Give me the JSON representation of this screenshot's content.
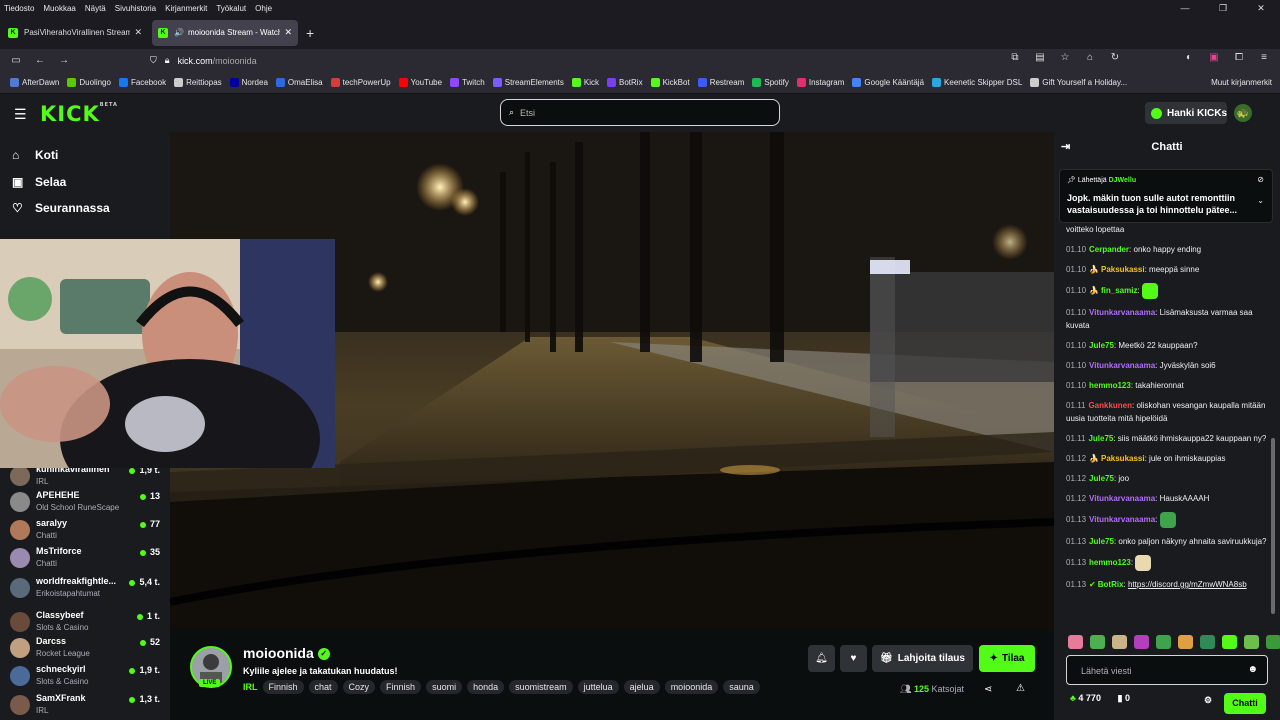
{
  "browser": {
    "menu": [
      "Tiedosto",
      "Muokkaa",
      "Näytä",
      "Sivuhistoria",
      "Kirjanmerkit",
      "Työkalut",
      "Ohje"
    ],
    "tabs": [
      {
        "title": "PasiViherahoVirallinen Stream",
        "active": false
      },
      {
        "title": "moioonida Stream - Watch",
        "active": true
      }
    ],
    "url_host": "kick.com",
    "url_path": "/moioonida",
    "bookmarks": [
      {
        "label": "AfterDawn",
        "color": "#4f7bd6"
      },
      {
        "label": "Duolingo",
        "color": "#58cc02"
      },
      {
        "label": "Facebook",
        "color": "#1877f2"
      },
      {
        "label": "Reittiopas",
        "color": "#cccccc"
      },
      {
        "label": "Nordea",
        "color": "#0000a0"
      },
      {
        "label": "OmaElisa",
        "color": "#2b6be0"
      },
      {
        "label": "techPowerUp",
        "color": "#d83b3b"
      },
      {
        "label": "YouTube",
        "color": "#ff0000"
      },
      {
        "label": "Twitch",
        "color": "#9146ff"
      },
      {
        "label": "StreamElements",
        "color": "#7a5cff"
      },
      {
        "label": "Kick",
        "color": "#53fc18"
      },
      {
        "label": "BotRix",
        "color": "#7b3ff2"
      },
      {
        "label": "KickBot",
        "color": "#53fc18"
      },
      {
        "label": "Restream",
        "color": "#3b5bfd"
      },
      {
        "label": "Spotify",
        "color": "#1db954"
      },
      {
        "label": "Instagram",
        "color": "#e1306c"
      },
      {
        "label": "Google Kääntäjä",
        "color": "#4285f4"
      },
      {
        "label": "Keenetic Skipper DSL",
        "color": "#2aa7e0"
      },
      {
        "label": "Gift Yourself a Holiday...",
        "color": "#cccccc"
      }
    ],
    "other_bookmarks": "Muut kirjanmerkit"
  },
  "site": {
    "logo": "KICK",
    "logo_beta": "BETA",
    "search_placeholder": "Etsi",
    "kicks_label": "Hanki KICKs"
  },
  "sidebar": {
    "nav": [
      {
        "label": "Koti",
        "icon": "home-icon"
      },
      {
        "label": "Selaa",
        "icon": "browse-icon"
      },
      {
        "label": "Seurannassa",
        "icon": "heart-icon"
      }
    ],
    "channels": [
      {
        "name": "kuninkavirallinen",
        "category": "IRL",
        "viewers": "1,9 t."
      },
      {
        "name": "APEHEHE",
        "category": "Old School RuneScape",
        "viewers": "13"
      },
      {
        "name": "saralyy",
        "category": "Chatti",
        "viewers": "77"
      },
      {
        "name": "MsTriforce",
        "category": "Chatti",
        "viewers": "35"
      },
      {
        "name": "worldfreakfightle...",
        "category": "Erikoistapahtumat",
        "viewers": "5,4 t."
      },
      {
        "name": "Classybeef",
        "category": "Slots & Casino",
        "viewers": "1 t."
      },
      {
        "name": "Darcss",
        "category": "Rocket League",
        "viewers": "52"
      },
      {
        "name": "schneckyirl",
        "category": "Slots & Casino",
        "viewers": "1,9 t."
      },
      {
        "name": "SamXFrank",
        "category": "IRL",
        "viewers": "1,3 t."
      }
    ]
  },
  "stream": {
    "streamer": "moioonida",
    "live_badge": "LIVE",
    "title": "Kyliile ajelee ja takatukan huudatus!",
    "category": "IRL",
    "tags": [
      "Finnish",
      "chat",
      "Cozy",
      "Finnish",
      "suomi",
      "honda",
      "suomistream",
      "juttelua",
      "ajelua",
      "moioonida",
      "sauna"
    ],
    "gift_label": "Lahjoita tilaus",
    "follow_label": "Tilaa",
    "viewer_count": "125",
    "viewer_label": "Katsojat"
  },
  "chat": {
    "title": "Chatti",
    "pinned_by_label": "Lähettäjä",
    "pinned_by": "DJWellu",
    "pinned_text": "Jopk. mäkin tuon sulle autot remonttiin vastaisuudessa ja toi hinnottelu pätee...",
    "messages": [
      {
        "time": "",
        "user": "",
        "color": "#ffffff",
        "text": "voitteko lopettaa"
      },
      {
        "time": "01.10",
        "user": "Cerpander",
        "color": "#53fc18",
        "text": "onko happy ending"
      },
      {
        "time": "01.10",
        "user": "Paksukassi",
        "color": "#f5c518",
        "text": "meeppä sinne"
      },
      {
        "time": "01.10",
        "user": "fin_samiz",
        "color": "#53fc18",
        "text": ""
      },
      {
        "time": "01.10",
        "user": "Vitunkarvanaama",
        "color": "#b36cff",
        "text": "Lisämaksusta varmaa saa kuvata"
      },
      {
        "time": "01.10",
        "user": "Jule75",
        "color": "#53fc18",
        "text": "Meetkö 22 kauppaan?"
      },
      {
        "time": "01.10",
        "user": "Vitunkarvanaama",
        "color": "#b36cff",
        "text": "Jyväskylän soi6"
      },
      {
        "time": "01.10",
        "user": "hemmo123",
        "color": "#53fc18",
        "text": "takahieronnat"
      },
      {
        "time": "01.11",
        "user": "Gankkunen",
        "color": "#ff4b4b",
        "text": "oliskohan vesangan kaupalla mitään uusia tuotteita mitä hipelöidä"
      },
      {
        "time": "01.11",
        "user": "Jule75",
        "color": "#53fc18",
        "text": "siis määtkö ihmiskauppa22 kauppaan ny?"
      },
      {
        "time": "01.12",
        "user": "Paksukassi",
        "color": "#f5c518",
        "text": "jule on ihmiskauppias"
      },
      {
        "time": "01.12",
        "user": "Jule75",
        "color": "#53fc18",
        "text": "joo"
      },
      {
        "time": "01.12",
        "user": "Vitunkarvanaama",
        "color": "#b36cff",
        "text": "HauskAAAAH"
      },
      {
        "time": "01.13",
        "user": "Vitunkarvanaama",
        "color": "#b36cff",
        "text": ""
      },
      {
        "time": "01.13",
        "user": "Jule75",
        "color": "#53fc18",
        "text": "onko paljon näkyny ahnaita saviruukkuja?"
      },
      {
        "time": "01.13",
        "user": "hemmo123",
        "color": "#53fc18",
        "text": ""
      },
      {
        "time": "01.13",
        "user": "BotRix",
        "color": "#53fc18",
        "text": "https://discord.gg/mZmwWNA8sb"
      }
    ],
    "input_placeholder": "Lähetä viesti",
    "kicks_count": "4 770",
    "points_count": "0",
    "send_label": "Chatti"
  }
}
